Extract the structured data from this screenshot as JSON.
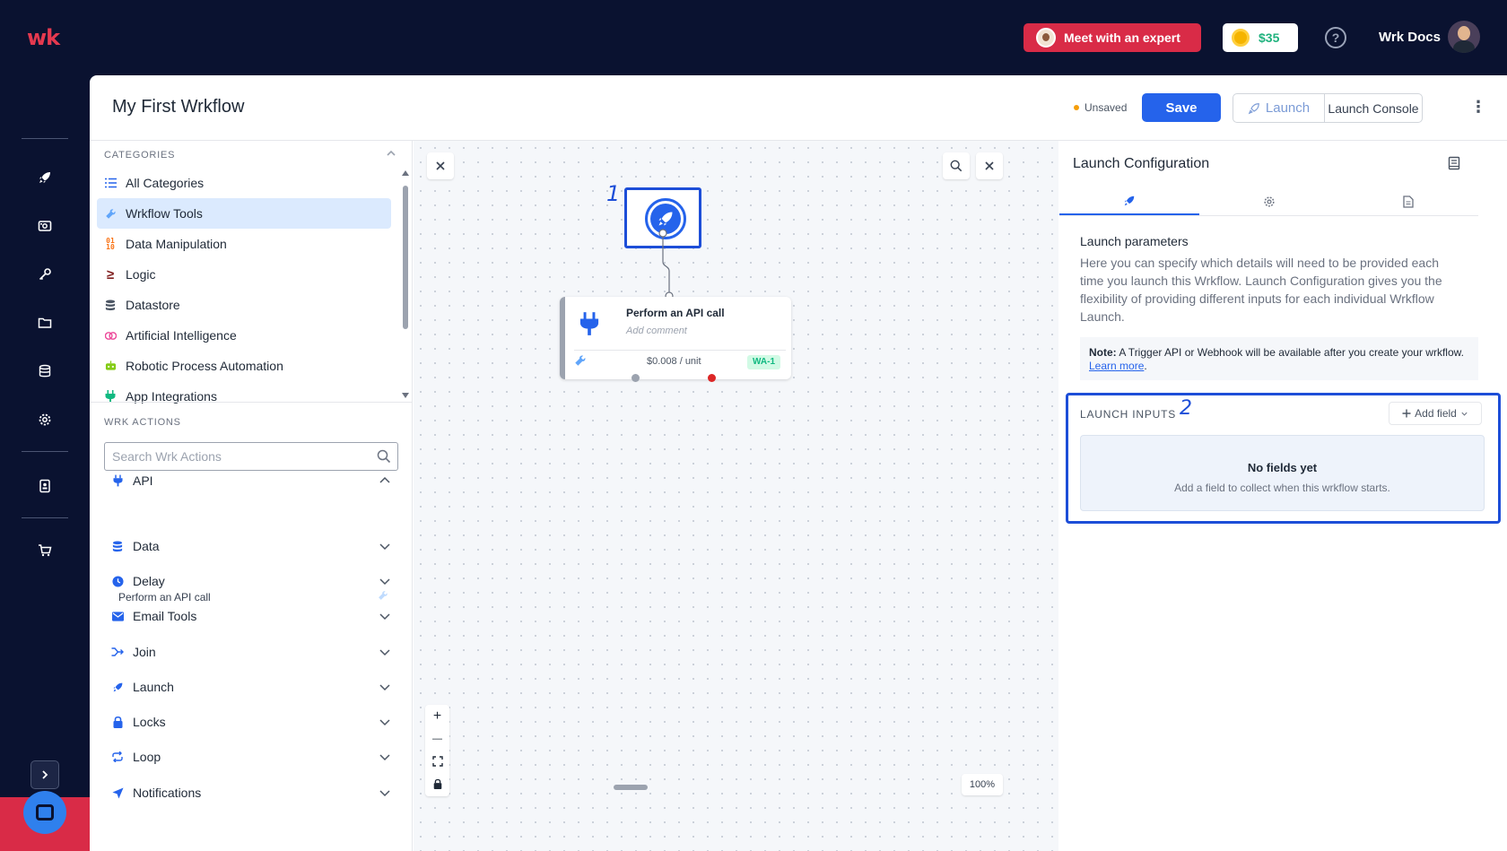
{
  "app": {
    "logo": "wk",
    "expert_button": "Meet with an expert",
    "credits": "$35",
    "help": "?",
    "user_label": "Wrk Docs"
  },
  "header": {
    "title": "My First Wrkflow",
    "unsaved": "Unsaved",
    "save": "Save",
    "launch": "Launch",
    "launch_console": "Launch Console",
    "more": "⋮"
  },
  "left_panel": {
    "categories_header": "CATEGORIES",
    "categories": [
      {
        "label": "All Categories",
        "icon": "list-icon",
        "color": "#2563eb"
      },
      {
        "label": "Wrkflow Tools",
        "icon": "wrench-icon",
        "color": "#60a5fa"
      },
      {
        "label": "Data Manipulation",
        "icon": "binary-icon",
        "color": "#f97316"
      },
      {
        "label": "Logic",
        "icon": "greater-equal-icon",
        "color": "#7f1d1d"
      },
      {
        "label": "Datastore",
        "icon": "database-icon",
        "color": "#4b5563"
      },
      {
        "label": "Artificial Intelligence",
        "icon": "brain-icon",
        "color": "#ec4899"
      },
      {
        "label": "Robotic Process Automation",
        "icon": "robot-icon",
        "color": "#84cc16"
      },
      {
        "label": "App Integrations",
        "icon": "plug-icon",
        "color": "#10b981"
      }
    ],
    "actions_header": "WRK ACTIONS",
    "search_placeholder": "Search Wrk Actions",
    "groups": [
      {
        "label": "API",
        "expanded": true
      },
      {
        "label": "Data"
      },
      {
        "label": "Delay"
      },
      {
        "label": "Email Tools"
      },
      {
        "label": "Join"
      },
      {
        "label": "Launch"
      },
      {
        "label": "Locks"
      },
      {
        "label": "Loop"
      },
      {
        "label": "Notifications"
      }
    ],
    "api_sub_item": "Perform an API call"
  },
  "canvas": {
    "step_1": "1",
    "api_node": {
      "title": "Perform an API call",
      "comment_placeholder": "Add comment",
      "price": "$0.008 / unit",
      "tag": "WA-1"
    },
    "zoom": "100%",
    "zoom_in": "+",
    "zoom_out": "—"
  },
  "right_panel": {
    "title": "Launch Configuration",
    "params_title": "Launch parameters",
    "params_desc": "Here you can specify which details will need to be provided each time you launch this Wrkflow. Launch Configuration gives you the flexibility of providing different inputs for each individual Wrkflow Launch.",
    "note_label": "Note:",
    "note_text": " A Trigger API or Webhook will be available after you create your wrkflow. ",
    "note_link": "Learn more",
    "note_end": ".",
    "step_2": "2",
    "inputs_label": "LAUNCH INPUTS",
    "add_field": "Add field",
    "empty_title": "No fields yet",
    "empty_sub": "Add a field to collect when this wrkflow starts."
  },
  "colors": {
    "brand_red": "#d92b47",
    "navy": "#0a1230",
    "primary_blue": "#2563eb",
    "highlight_blue": "#1d4ed8"
  }
}
